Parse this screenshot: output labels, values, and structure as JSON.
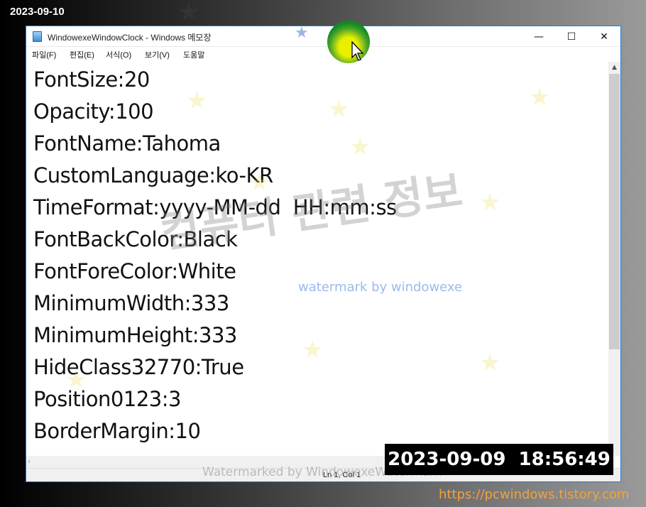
{
  "desktop": {
    "date_label": "2023-09-10",
    "site_url": "https://pcwindows.tistory.com"
  },
  "window": {
    "title": "WindowexeWindowClock - Windows 메모장",
    "icon": "notepad-icon",
    "controls": {
      "minimize": "—",
      "maximize": "☐",
      "close": "✕"
    }
  },
  "menu": {
    "items": [
      {
        "label": "파일(F)"
      },
      {
        "label": "편집(E)"
      },
      {
        "label": "서식(O)"
      },
      {
        "label": "보기(V)"
      },
      {
        "label": "도움말"
      }
    ]
  },
  "editor": {
    "lines": [
      "FontSize:20",
      "Opacity:100",
      "FontName:Tahoma",
      "CustomLanguage:ko-KR",
      "TimeFormat:yyyy-MM-dd  HH:mm:ss",
      "FontBackColor:Black",
      "FontForeColor:White",
      "MinimumWidth:333",
      "MinimumHeight:333",
      "HideClass32770:True",
      "Position0123:3",
      "BorderMargin:10"
    ]
  },
  "status": {
    "position": "Ln 1, Col 1"
  },
  "watermarks": {
    "korean": "컴퓨터 관련 정보",
    "blue": "watermark by windowexe",
    "bottom": "Watermarked by WindowexeWatermark"
  },
  "clock": {
    "text": "2023-09-09  18:56:49"
  },
  "colors": {
    "accent": "#2a78d6",
    "clock_bg": "#000000",
    "url": "#f2a33a"
  }
}
